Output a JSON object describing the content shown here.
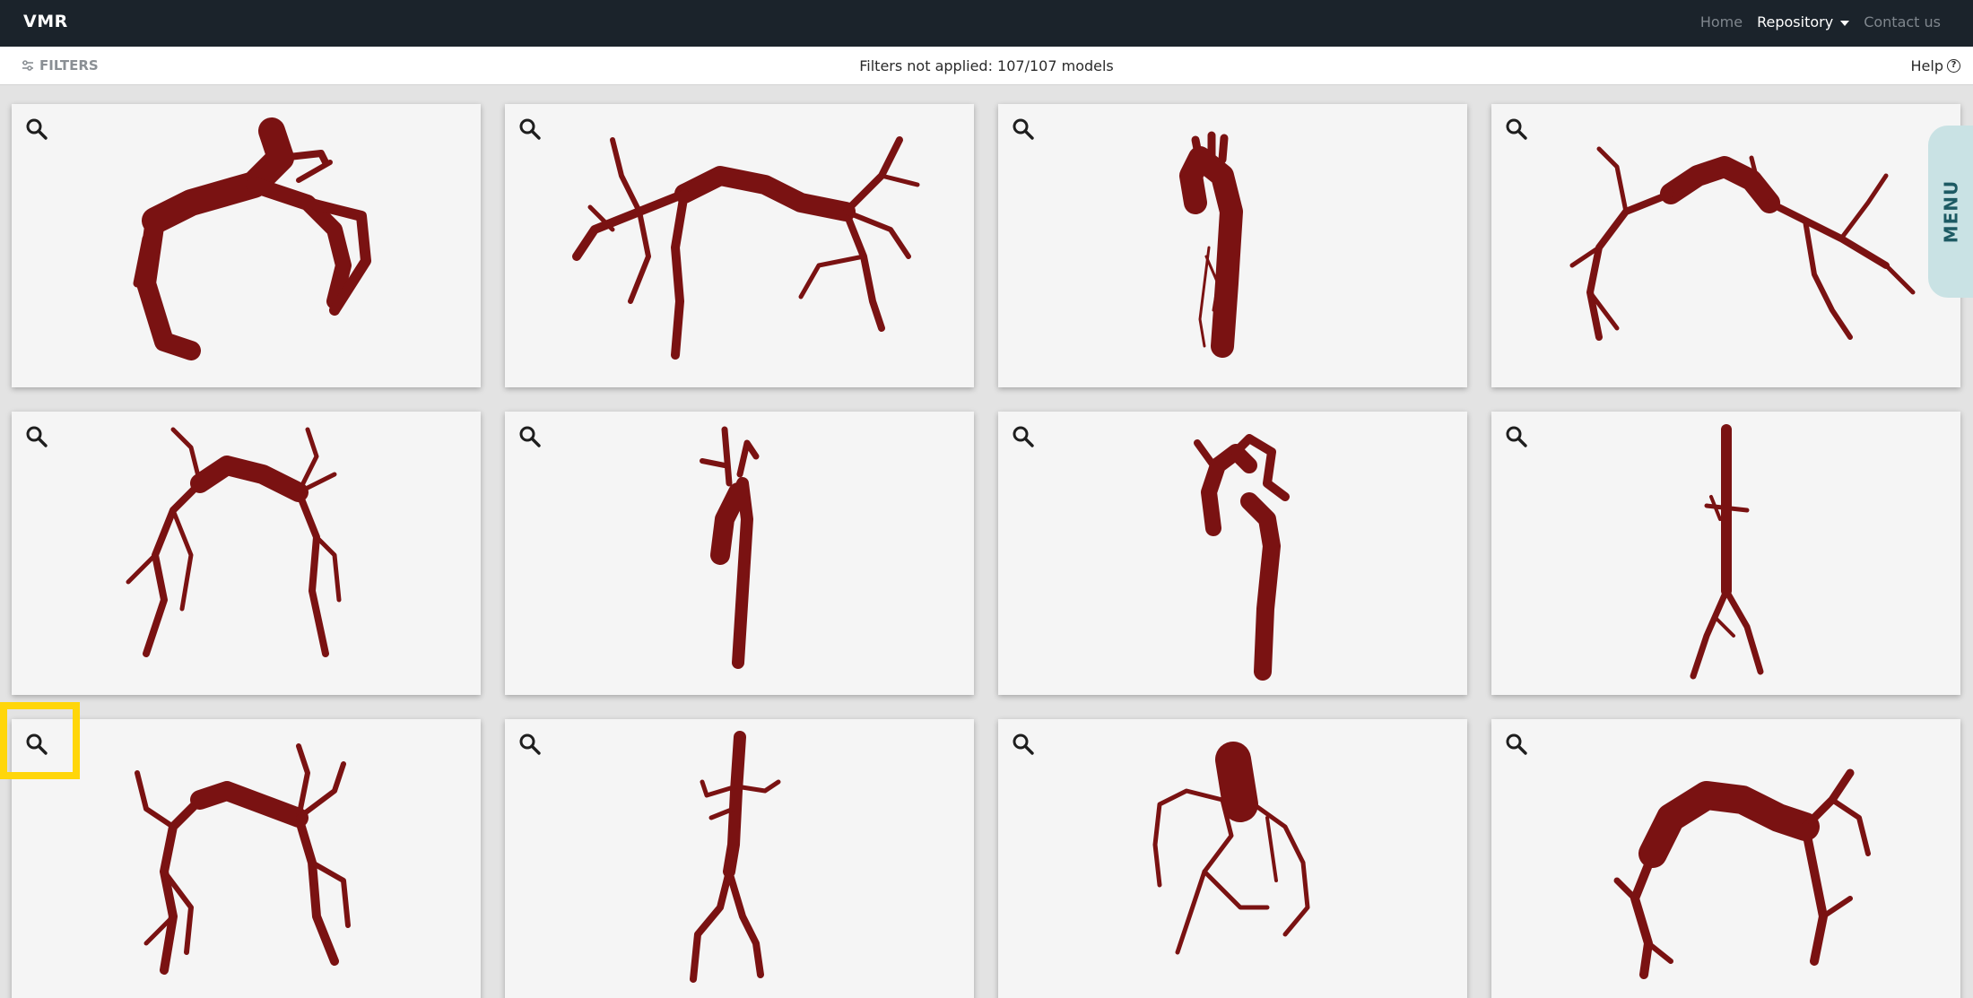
{
  "navbar": {
    "brand": "VMR",
    "links": [
      "Home",
      "Repository",
      "Contact us"
    ]
  },
  "filterbar": {
    "filters_label": "FILTERS",
    "status_text": "Filters not applied: 107/107 models",
    "help_label": "Help"
  },
  "side_tab": {
    "label": "MENU"
  },
  "grid": {
    "columns": 4,
    "visible_rows": 3,
    "card_count": 12,
    "card_action_icon": "magnifier-icon"
  },
  "colors": {
    "navbar_bg": "#1b232b",
    "vessel": "#7a1212",
    "highlight": "#ffd60a",
    "menu_tab_bg": "#c9e2e4"
  }
}
